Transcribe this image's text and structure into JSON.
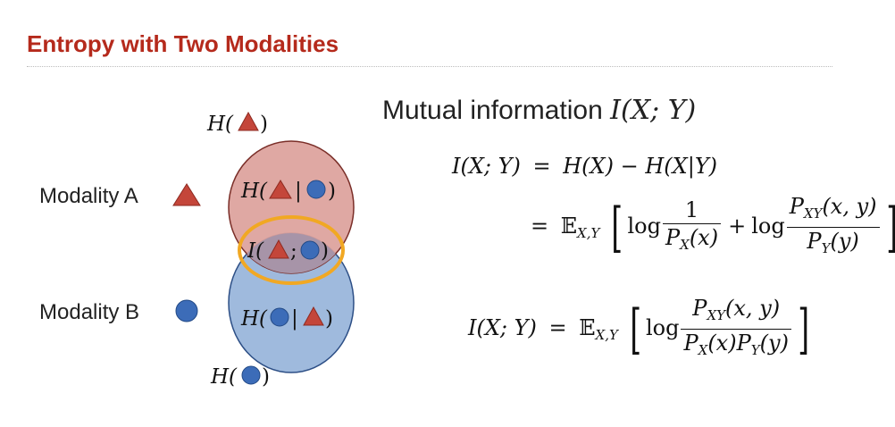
{
  "slide": {
    "title": "Entropy with Two Modalities"
  },
  "modalities": {
    "a_label": "Modality A",
    "a_symbol": "red-triangle-icon",
    "b_label": "Modality B",
    "b_symbol": "blue-circle-icon"
  },
  "venn": {
    "h_a": {
      "prefix": "H(",
      "suffix": ")"
    },
    "h_b": {
      "prefix": "H(",
      "suffix": ")"
    },
    "h_a_given_b": {
      "prefix": "H(",
      "middle": "|",
      "suffix": ")"
    },
    "mutual": {
      "prefix": "I(",
      "middle": ";",
      "suffix": ")"
    },
    "h_b_given_a": {
      "prefix": "H(",
      "middle": "|",
      "suffix": ")"
    },
    "colors": {
      "circle_a_fill": "#dca19b",
      "circle_b_fill": "#9fbadd",
      "overlap_fill": "#a794a8",
      "highlight_ring": "#f1a823",
      "triangle": "#c4463a",
      "circle_icon": "#3c6cb8"
    }
  },
  "mutual_info": {
    "heading": "Mutual information",
    "heading_math": "I(X; Y)",
    "eq1_lhs": "I(X; Y)",
    "eq1_rhs": "H(X) − H(X|Y)",
    "eq2_expect": "𝔼",
    "eq2_expect_sub": "X,Y",
    "eq2_log1": "log",
    "eq2_frac1_num": "1",
    "eq2_frac1_den_p": "P",
    "eq2_frac1_den_sub": "X",
    "eq2_frac1_den_arg": "(x)",
    "eq2_plus": "+",
    "eq2_log2": "log",
    "eq2_frac2_num_p": "P",
    "eq2_frac2_num_sub": "XY",
    "eq2_frac2_num_arg": "(x, y)",
    "eq2_frac2_den_p": "P",
    "eq2_frac2_den_sub": "Y",
    "eq2_frac2_den_arg": "(y)",
    "eq3_lhs": "I(X; Y)",
    "eq3_expect": "𝔼",
    "eq3_expect_sub": "X,Y",
    "eq3_log": "log",
    "eq3_num_p": "P",
    "eq3_num_sub": "XY",
    "eq3_num_arg": "(x, y)",
    "eq3_den_p1": "P",
    "eq3_den_sub1": "X",
    "eq3_den_arg1": "(x)",
    "eq3_den_p2": "P",
    "eq3_den_sub2": "Y",
    "eq3_den_arg2": "(y)"
  }
}
